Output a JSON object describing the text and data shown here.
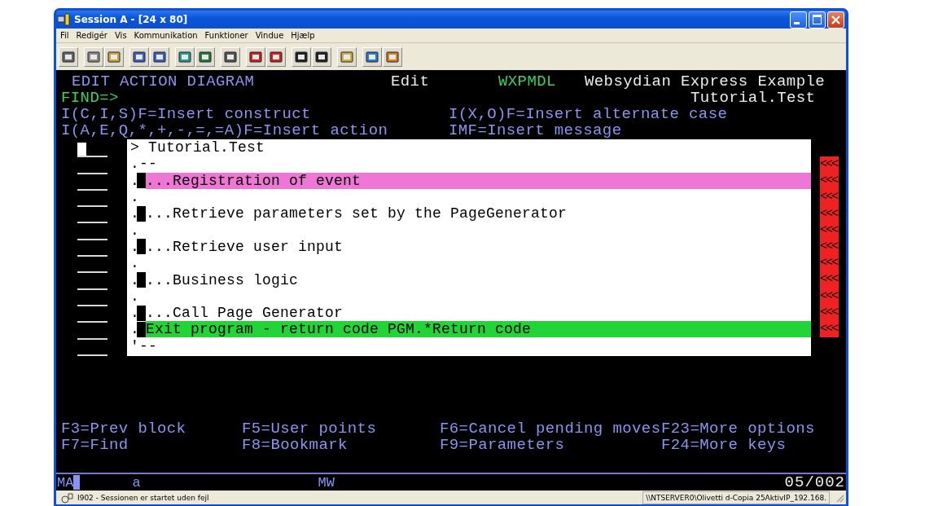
{
  "window": {
    "title": "Session A - [24 x 80]"
  },
  "menu": [
    "Fil",
    "Redigér",
    "Vis",
    "Kommunikation",
    "Funktioner",
    "Vindue",
    "Hjælp"
  ],
  "terminal": {
    "header": {
      "screen": "EDIT ACTION DIAGRAM",
      "mode": "Edit",
      "program": "WXPMDL",
      "application": "Websydian Express Example"
    },
    "find": {
      "label": "FIND=>",
      "context": "Tutorial.Test"
    },
    "hints": [
      [
        "I(C,I,S)F=Insert construct",
        "I(X,O)F=Insert alternate case"
      ],
      [
        "I(A,E,Q,*,+,-,=,=A)F=Insert action",
        "IMF=Insert message"
      ]
    ],
    "entry_fields": [
      {
        "cursor": true
      },
      {
        "cursor": false
      },
      {
        "cursor": false
      },
      {
        "cursor": false
      },
      {
        "cursor": false
      },
      {
        "cursor": false
      },
      {
        "cursor": false
      },
      {
        "cursor": false
      },
      {
        "cursor": false
      },
      {
        "cursor": false
      },
      {
        "cursor": false
      },
      {
        "cursor": false
      },
      {
        "cursor": false
      }
    ],
    "diagram": [
      {
        "kind": "title",
        "text": "> Tutorial.Test"
      },
      {
        "kind": "plain",
        "text": ".--"
      },
      {
        "kind": "action",
        "prefix": ".",
        "text": "...Registration of event",
        "color": "#ee77d6"
      },
      {
        "kind": "plain",
        "text": "."
      },
      {
        "kind": "action",
        "prefix": ".",
        "text": "...Retrieve parameters set by the PageGenerator"
      },
      {
        "kind": "plain",
        "text": "."
      },
      {
        "kind": "action",
        "prefix": ".",
        "text": "...Retrieve user input"
      },
      {
        "kind": "plain",
        "text": "."
      },
      {
        "kind": "action",
        "prefix": ".",
        "text": "...Business logic"
      },
      {
        "kind": "plain",
        "text": "."
      },
      {
        "kind": "action",
        "prefix": ".",
        "text": "...Call Page Generator"
      },
      {
        "kind": "action",
        "prefix": ".",
        "text": "Exit program - return code PGM.*Return code",
        "color": "#22d435"
      },
      {
        "kind": "plain",
        "text": "'--"
      }
    ],
    "markers": [
      "<<<",
      "<<<",
      "<<<",
      "<<<",
      "<<<",
      "<<<",
      "<<<",
      "<<<",
      "<<<",
      "<<<",
      "<<<"
    ],
    "function_keys": [
      [
        "F3=Prev block",
        "F5=User points",
        "F6=Cancel pending moves",
        "F23=More options"
      ],
      [
        "F7=Find",
        "F8=Bookmark",
        "F9=Parameters",
        "F24=More keys"
      ]
    ]
  },
  "oia": {
    "mode": "MA",
    "shift": "a",
    "input": "MW",
    "cursor_position": "05/002"
  },
  "status_bar": {
    "message": "I902 - Sessionen er startet uden fejl",
    "connection": "\\\\NTSERVER0\\Olivetti d-Copia 25AktivIP_192.168."
  }
}
